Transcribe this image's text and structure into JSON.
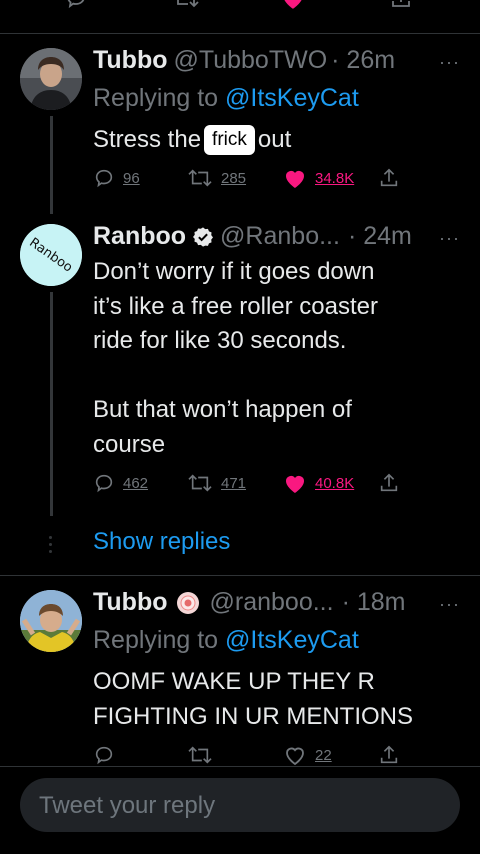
{
  "tweets": [
    {
      "name": "Tubbo",
      "handle": "@TubboTWO",
      "time": "· 26m",
      "replying_prefix": "Replying to",
      "replying_to": "@ItsKeyCat",
      "text_before": "Stress the",
      "text_badge": "frick",
      "text_after": "out",
      "replies": "96",
      "retweets": "285",
      "likes": "34.8K"
    },
    {
      "name": "Ranboo",
      "handle": "@Ranbo...",
      "time": "· 24m",
      "avatar_text": "Ranboo",
      "text_lines": [
        "Don’t worry if it goes down",
        "it’s like a free roller coaster",
        "ride for like 30 seconds.",
        "",
        "But that won’t happen of",
        "course"
      ],
      "replies": "462",
      "retweets": "471",
      "likes": "40.8K"
    },
    {
      "name": "Tubbo",
      "handle": "@ranboo...",
      "time": "· 18m",
      "replying_prefix": "Replying to",
      "replying_to": "@ItsKeyCat",
      "text_lines": [
        "OOMF WAKE UP THEY R",
        "FIGHTING IN UR MENTIONS"
      ],
      "likes": "22"
    }
  ],
  "show_replies": "Show replies",
  "more_icon": "···",
  "compose": {
    "placeholder": "Tweet your reply"
  },
  "colors": {
    "background": "#000000",
    "accent": "#1d9bf0",
    "like": "#f91880",
    "secondary": "#71767b"
  }
}
